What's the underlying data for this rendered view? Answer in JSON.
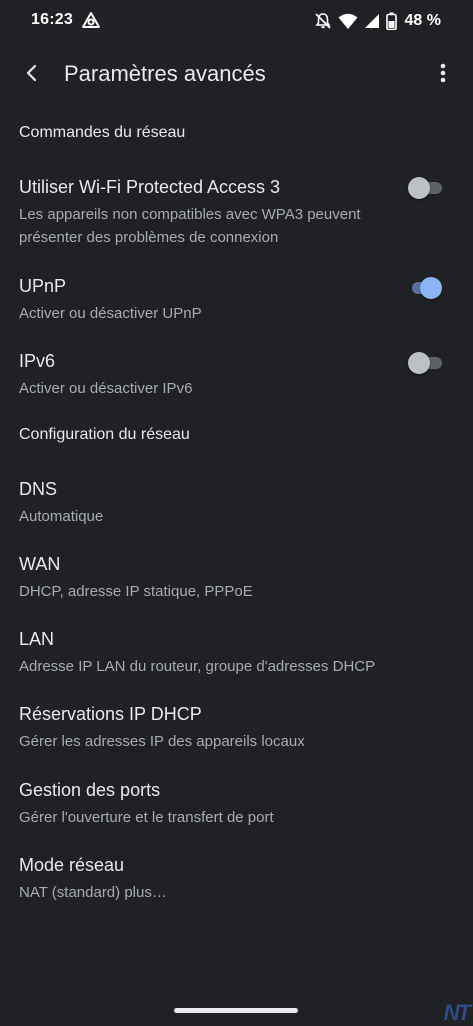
{
  "status_bar": {
    "time": "16:23",
    "app_icon": "sync-app-icon",
    "icons": [
      "notifications-off-icon",
      "wifi-icon",
      "cellular-signal-icon",
      "battery-icon"
    ],
    "battery": "48 %"
  },
  "app_bar": {
    "back_icon": "arrow-back-icon",
    "title": "Paramètres avancés",
    "more_icon": "more-vert-icon"
  },
  "sections": {
    "network_controls": "Commandes du réseau",
    "network_config": "Configuration du réseau"
  },
  "prefs": {
    "wpa3": {
      "title": "Utiliser Wi-Fi Protected Access 3",
      "summary": "Les appareils non compatibles avec WPA3 peuvent présenter des problèmes de connexion",
      "enabled": false
    },
    "upnp": {
      "title": "UPnP",
      "summary": "Activer ou désactiver UPnP",
      "enabled": true
    },
    "ipv6": {
      "title": "IPv6",
      "summary": "Activer ou désactiver IPv6",
      "enabled": false
    },
    "dns": {
      "title": "DNS",
      "summary": "Automatique"
    },
    "wan": {
      "title": "WAN",
      "summary": "DHCP, adresse IP statique, PPPoE"
    },
    "lan": {
      "title": "LAN",
      "summary": "Adresse IP LAN du routeur, groupe d'adresses DHCP"
    },
    "dhcp": {
      "title": "Réservations IP DHCP",
      "summary": "Gérer les adresses IP des appareils locaux"
    },
    "ports": {
      "title": "Gestion des ports",
      "summary": "Gérer l'ouverture et le transfert de port"
    },
    "mode": {
      "title": "Mode réseau",
      "summary": "NAT (standard) plus…"
    }
  },
  "colors": {
    "background": "#202124",
    "accent": "#8ab4f8",
    "text_primary": "#e8eaed",
    "text_secondary": "#a8acb1"
  },
  "watermark": "NT"
}
